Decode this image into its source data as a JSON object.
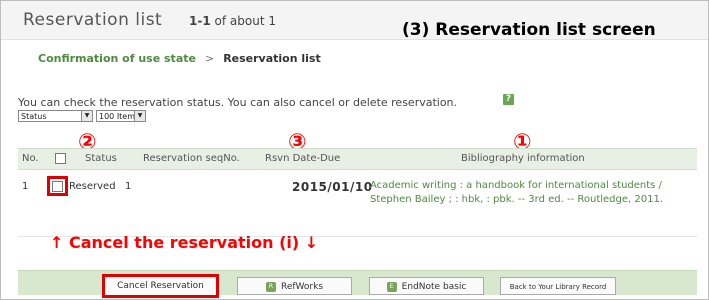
{
  "header": {
    "title": "Reservation list",
    "count_range": "1-1",
    "count_suffix": "of about 1"
  },
  "annotation": {
    "screen_title": "(3) Reservation list screen",
    "markers": [
      "②",
      "③",
      "①"
    ],
    "cancel_note": "↑ Cancel the reservation (i) ↓"
  },
  "breadcrumb": {
    "link": "Confirmation of use state",
    "separator": ">",
    "current": "Reservation list"
  },
  "description": "You can check the reservation status. You can also cancel or delete reservation.",
  "help_icon": "?",
  "filters": {
    "status_select": "Status",
    "items_select": "100 Items"
  },
  "table": {
    "headers": {
      "no": "No.",
      "status": "Status",
      "seq": "Reservation seqNo.",
      "date": "Rsvn Date-Due",
      "biblio": "Bibliography information"
    },
    "rows": [
      {
        "no": "1",
        "status": "Reserved",
        "seq": "1",
        "date": "2015/01/10",
        "biblio": "Academic writing : a handbook for international students / Stephen Bailey ; : hbk, : pbk. -- 3rd ed. -- Routledge, 2011."
      }
    ]
  },
  "buttons": {
    "cancel": "Cancel Reservation",
    "refworks": "RefWorks",
    "endnote": "EndNote basic",
    "back": "Back to Your Library Record"
  },
  "colors": {
    "link_green": "#4d8b3e",
    "annotation_red": "#ff0000",
    "header_row_bg": "#e8f0e6",
    "button_bar_bg": "#d7e8cf"
  }
}
